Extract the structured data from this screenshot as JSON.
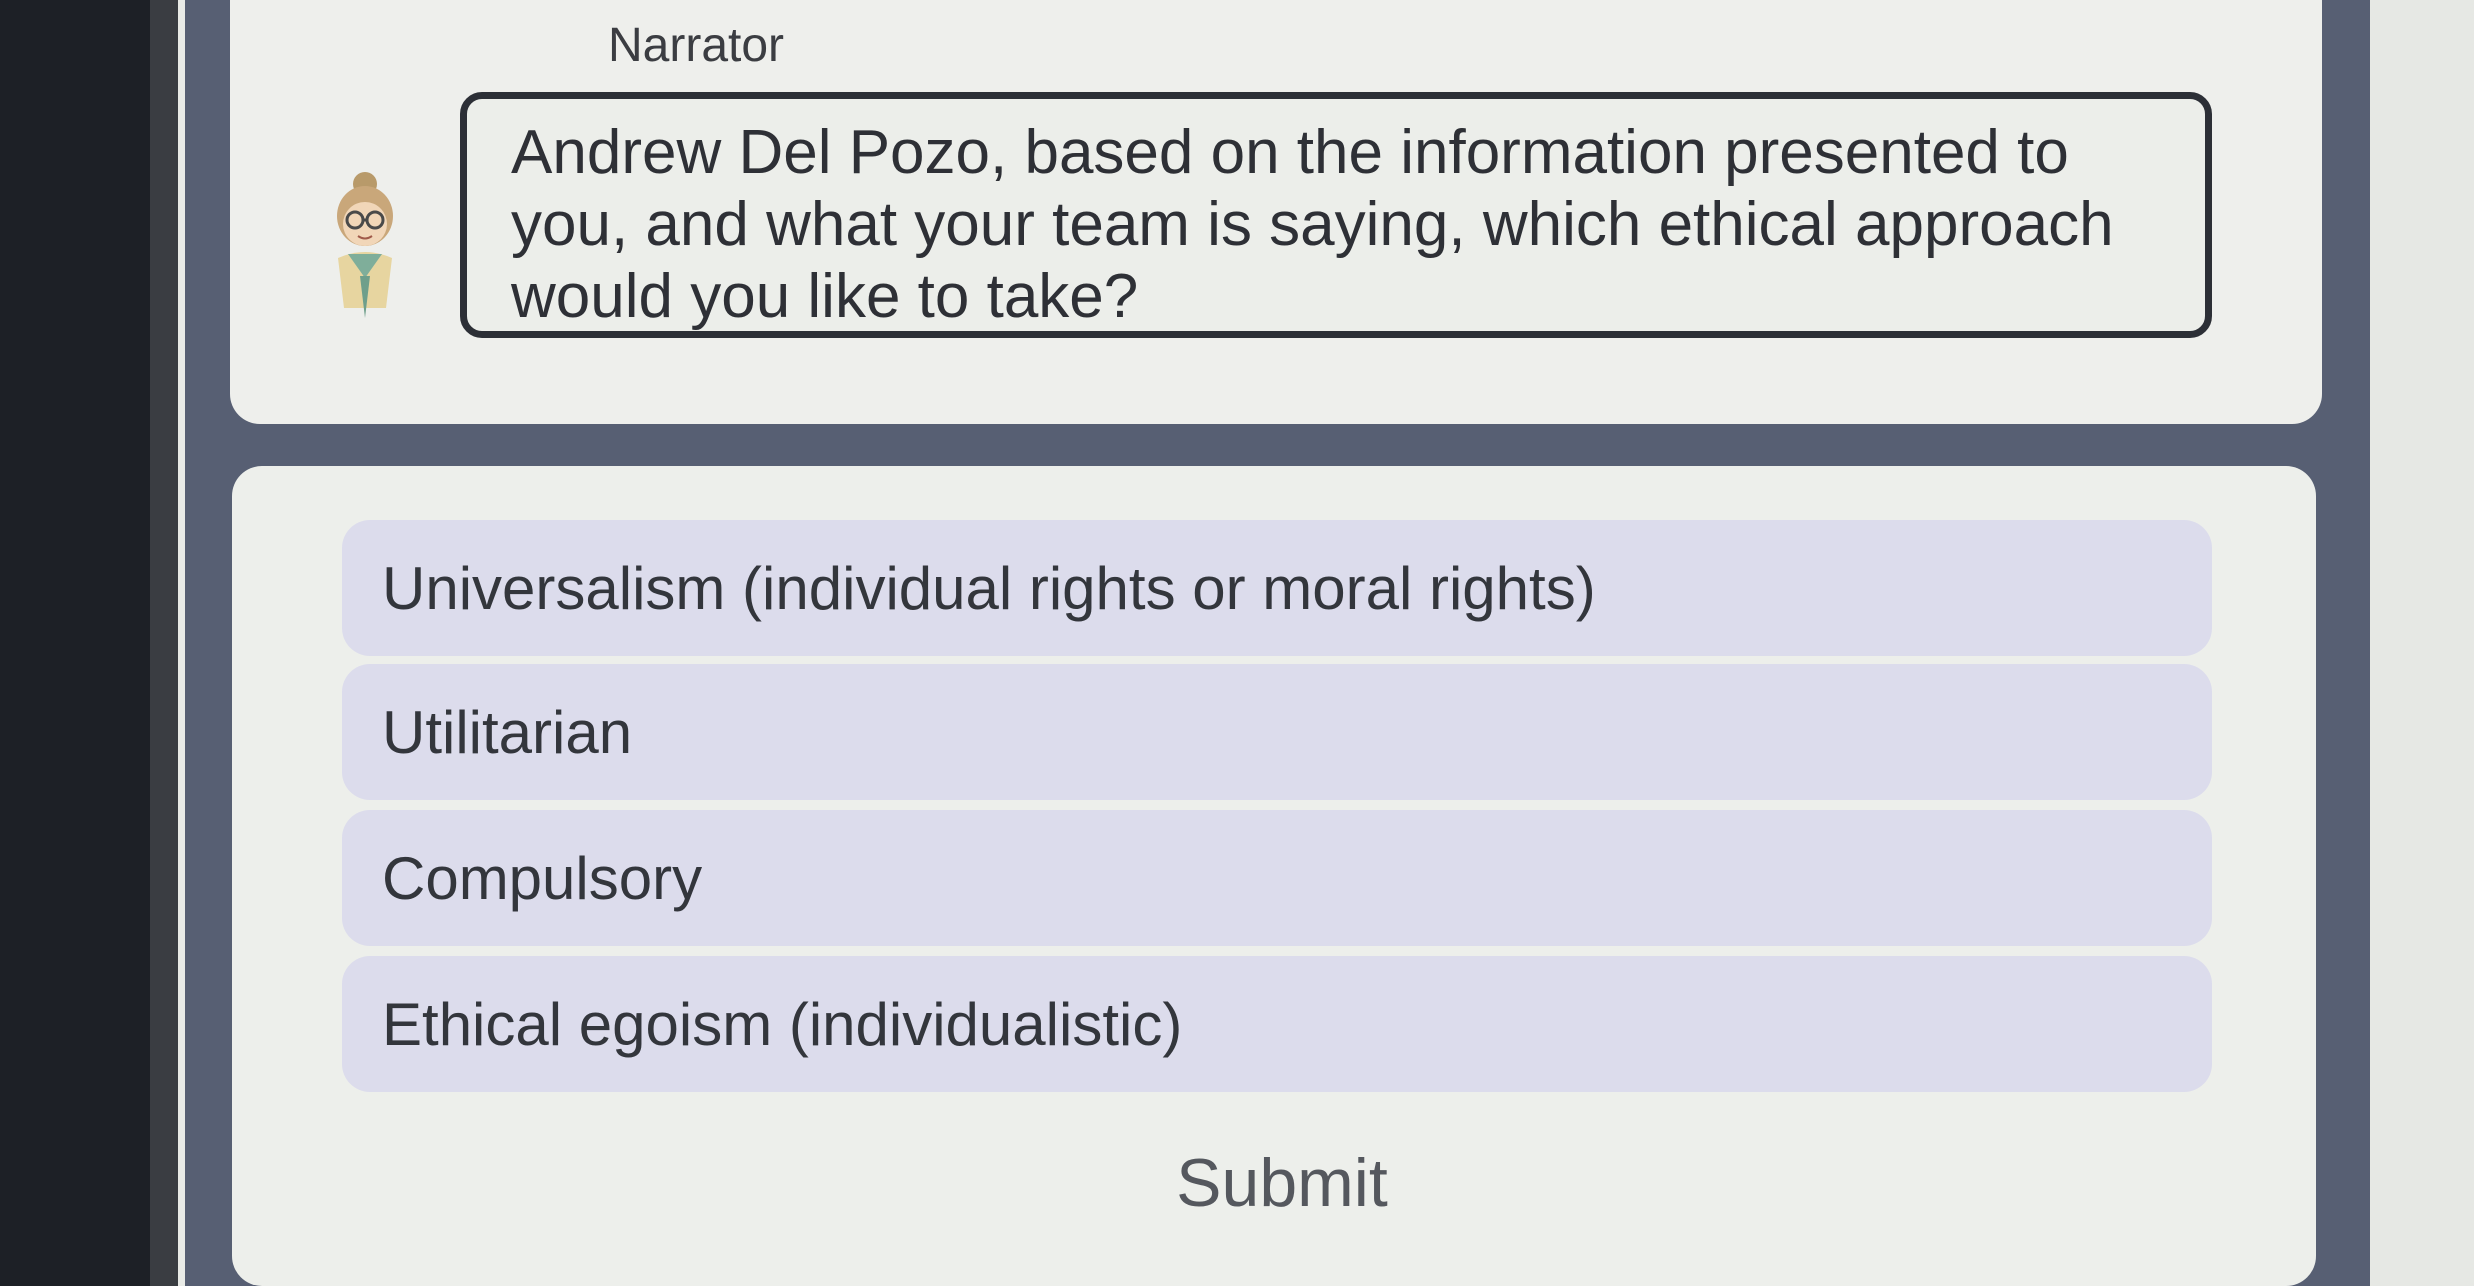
{
  "narrator": {
    "name": "Narrator",
    "avatar_icon": "narrator-avatar-icon",
    "message": "Andrew Del Pozo, based on the information presented to you, and what your team is saying, which ethical approach would you like to take?"
  },
  "options": [
    {
      "label": "Universalism (individual rights or moral rights)"
    },
    {
      "label": "Utilitarian"
    },
    {
      "label": "Compulsory"
    },
    {
      "label": "Ethical egoism (individualistic)"
    }
  ],
  "submit": {
    "label": "Submit"
  },
  "colors": {
    "option_background": "#dcdcec",
    "card_background": "#eeefec",
    "frame_background": "#575f73"
  }
}
